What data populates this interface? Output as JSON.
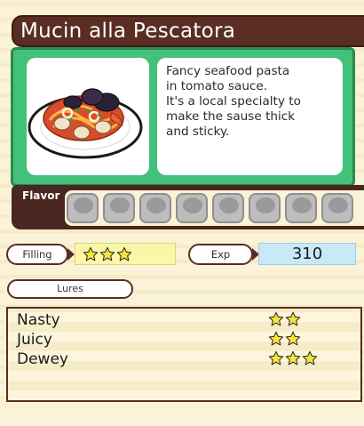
{
  "dish": {
    "title": "Mucin alla Pescatora",
    "description_lines": [
      "Fancy seafood pasta",
      "in tomato sauce.",
      "It's a local specialty to",
      "make the sause thick",
      "and sticky."
    ],
    "image_icon": "seafood-pasta-plate-icon"
  },
  "flavor": {
    "label": "Flavor",
    "slots": [
      {
        "caption": "",
        "icon": "locked-flavor-icon"
      },
      {
        "caption": "",
        "icon": "locked-flavor-icon"
      },
      {
        "caption": "",
        "icon": "locked-flavor-icon"
      },
      {
        "caption": "",
        "icon": "locked-flavor-icon"
      },
      {
        "caption": "",
        "icon": "locked-flavor-icon"
      },
      {
        "caption": "",
        "icon": "locked-flavor-icon"
      },
      {
        "caption": "",
        "icon": "locked-flavor-icon"
      },
      {
        "caption": "",
        "icon": "locked-flavor-icon"
      }
    ]
  },
  "stats": {
    "filling_label": "Filling",
    "filling_stars": 3,
    "exp_label": "Exp",
    "exp_value": "310"
  },
  "lures": {
    "label": "Lures",
    "items": [
      {
        "name": "Nasty",
        "stars": 2
      },
      {
        "name": "Juicy",
        "stars": 2
      },
      {
        "name": "Dewey",
        "stars": 3
      }
    ]
  },
  "colors": {
    "title_bg": "#5a2d22",
    "panel_green": "#43c07a",
    "star_fill": "#f7e43a",
    "filling_bg": "#faf7a8",
    "exp_bg": "#c8e9f7"
  }
}
